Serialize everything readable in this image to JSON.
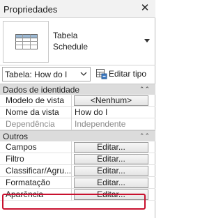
{
  "panel": {
    "title": "Propriedades",
    "close_icon": "close-icon"
  },
  "type_selector": {
    "icon": "schedule-table-icon",
    "name_line1": "Tabela",
    "name_line2": "Schedule"
  },
  "instance": {
    "selected": "Tabela: How do I",
    "edit_type_label": "Editar tipo",
    "edit_type_icon": "edit-type-icon"
  },
  "groups": [
    {
      "label": "Dados de identidade",
      "rows": [
        {
          "name": "Modelo de vista",
          "value": "<Nenhum>"
        },
        {
          "name": "Nome da vista",
          "value": "How do I"
        },
        {
          "name": "Dependência",
          "value": "Independente"
        }
      ]
    },
    {
      "label": "Outros",
      "rows": [
        {
          "name": "Campos",
          "value": "Editar..."
        },
        {
          "name": "Filtro",
          "value": "Editar..."
        },
        {
          "name": "Classificar/Agru...",
          "value": "Editar..."
        },
        {
          "name": "Formatação",
          "value": "Editar..."
        },
        {
          "name": "Aparência",
          "value": "Editar..."
        }
      ]
    }
  ],
  "colors": {
    "highlight": "#c8102e",
    "group_header_bg": "#dcdcdc"
  }
}
